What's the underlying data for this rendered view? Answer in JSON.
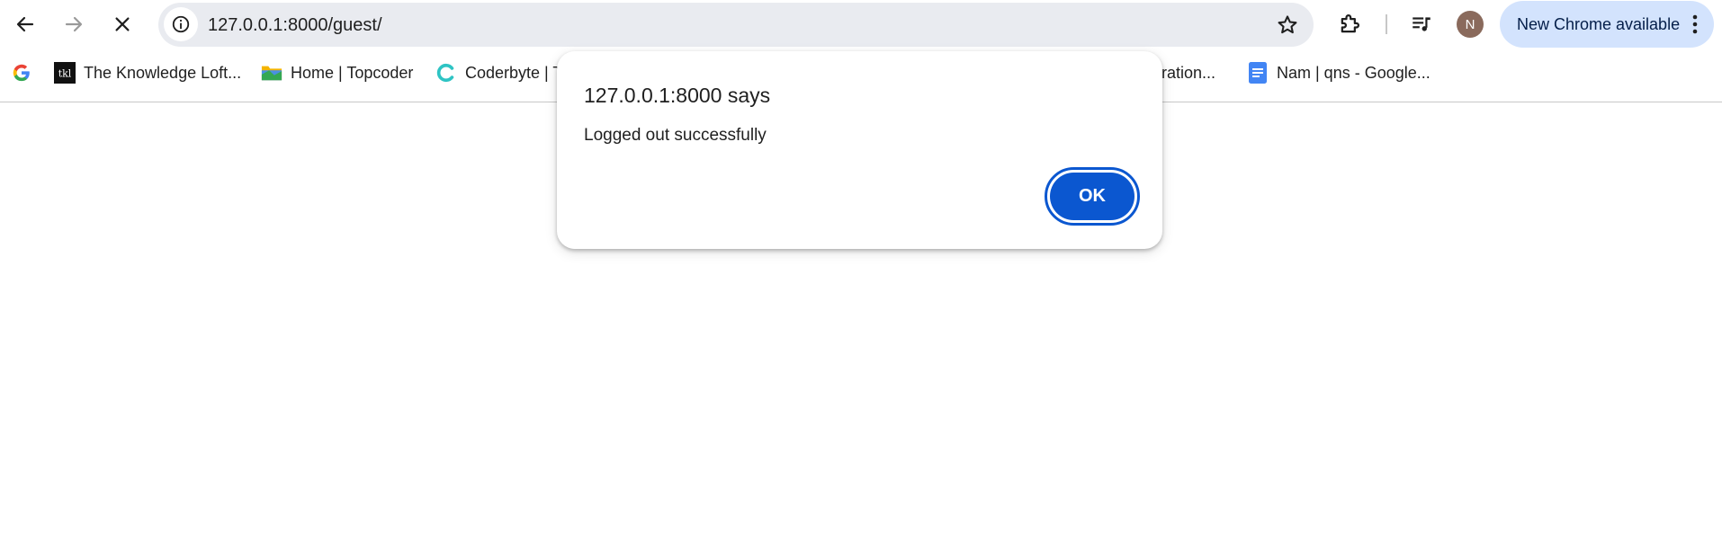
{
  "browser": {
    "url": "127.0.0.1:8000/guest/",
    "profile_initial": "N",
    "update_label": "New Chrome available",
    "accent_color": "#0b57d0"
  },
  "bookmarks": [
    {
      "label": "",
      "icon": "google-g-icon"
    },
    {
      "label": "The Knowledge Loft...",
      "icon": "tkl-logo-icon"
    },
    {
      "label": "Home | Topcoder",
      "icon": "topcoder-folder-icon"
    },
    {
      "label": "Coderbyte | T",
      "icon": "coderbyte-icon"
    },
    {
      "label": "stration...",
      "icon": ""
    },
    {
      "label": "Nam | qns - Google...",
      "icon": "google-docs-icon"
    }
  ],
  "dialog": {
    "title": "127.0.0.1:8000 says",
    "message": "Logged out successfully",
    "ok_label": "OK"
  }
}
